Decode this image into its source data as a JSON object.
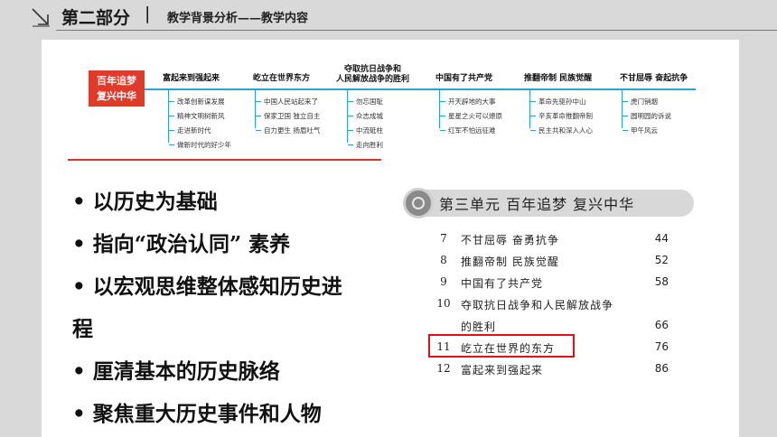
{
  "header": {
    "part": "第二部分",
    "separator": "|",
    "subtitle": "教学背景分析——教学内容",
    "icon": "corner-arrow-icon"
  },
  "mindmap": {
    "root": [
      "百年追梦",
      "复兴中华"
    ],
    "branches": [
      {
        "title": [
          "富起来到强起来"
        ],
        "leaves": [
          "改革创新谋发展",
          "精神文明树新风",
          "走进新时代",
          "做新时代的好少年"
        ]
      },
      {
        "title": [
          "屹立在世界东方"
        ],
        "leaves": [
          "中国人民站起来了",
          "保家卫国 独立自主",
          "自力更生 扬眉吐气"
        ]
      },
      {
        "title": [
          "夺取抗日战争和",
          "人民解放战争的胜利"
        ],
        "leaves": [
          "勿忘国耻",
          "众志成城",
          "中流砥柱",
          "走向胜利"
        ]
      },
      {
        "title": [
          "中国有了共产党"
        ],
        "leaves": [
          "开天辟地的大事",
          "星星之火可以燎原",
          "红军不怕远征难"
        ]
      },
      {
        "title": [
          "推翻帝制 民族觉醒"
        ],
        "leaves": [
          "革命先驱孙中山",
          "辛亥革命推翻帝制",
          "民主共和深入人心"
        ]
      },
      {
        "title": [
          "不甘屈辱 奋起抗争"
        ],
        "leaves": [
          "虎门销烟",
          "圆明园的诉说",
          "甲午风云"
        ]
      }
    ]
  },
  "bullets": [
    "• 以历史为基础",
    "• 指向“政治认同” 素养",
    "• 以宏观思维整体感知历史进",
    "程",
    "• 厘清基本的历史脉络",
    "• 聚焦重大历史事件和人物"
  ],
  "textbook": {
    "unit_title": "第三单元 百年追梦 复兴中华",
    "toc": [
      {
        "num": "7",
        "name": "不甘屈辱 奋勇抗争",
        "page": "44"
      },
      {
        "num": "8",
        "name": "推翻帝制 民族觉醒",
        "page": "52"
      },
      {
        "num": "9",
        "name": "中国有了共产党",
        "page": "58"
      },
      {
        "num": "10",
        "name": "夺取抗日战争和人民解放战争",
        "page": ""
      },
      {
        "num": "",
        "name": "的胜利",
        "page": "66"
      },
      {
        "num": "11",
        "name": "屹立在世界的东方",
        "page": "76"
      },
      {
        "num": "12",
        "name": "富起来到强起来",
        "page": "86"
      }
    ],
    "highlight_color": "#e0101a"
  },
  "colors": {
    "accent_red": "#e03a2b",
    "line_blue": "#2aa3c6"
  }
}
